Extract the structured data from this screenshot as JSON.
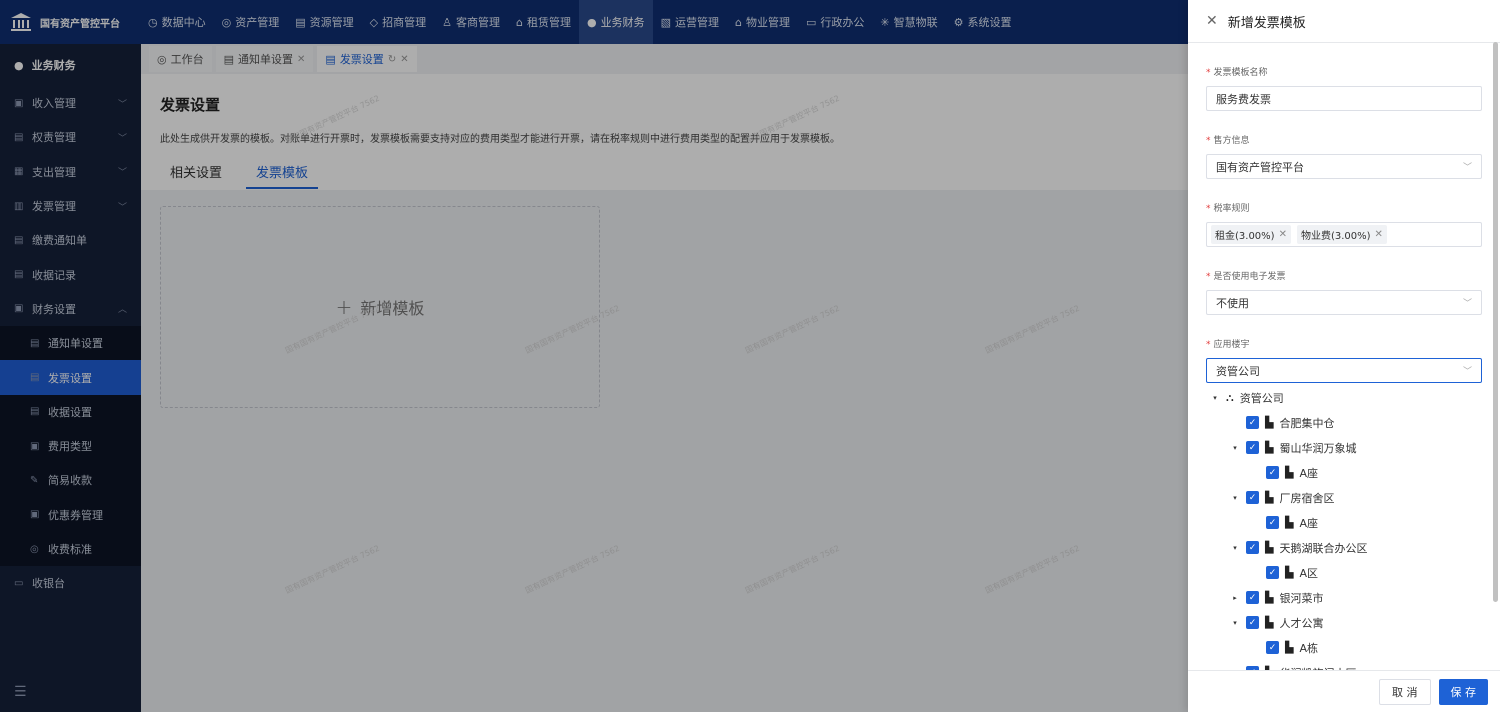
{
  "app": {
    "name": "国有资产管控平台"
  },
  "topnav": [
    {
      "label": "数据中心",
      "icon": "◷"
    },
    {
      "label": "资产管理",
      "icon": "◎"
    },
    {
      "label": "资源管理",
      "icon": "▤"
    },
    {
      "label": "招商管理",
      "icon": "◇"
    },
    {
      "label": "客商管理",
      "icon": "♙"
    },
    {
      "label": "租赁管理",
      "icon": "⌂"
    },
    {
      "label": "业务财务",
      "icon": "●"
    },
    {
      "label": "运营管理",
      "icon": "▧"
    },
    {
      "label": "物业管理",
      "icon": "⌂"
    },
    {
      "label": "行政办公",
      "icon": "▭"
    },
    {
      "label": "智慧物联",
      "icon": "✳"
    },
    {
      "label": "系统设置",
      "icon": "⚙"
    }
  ],
  "sidebar": {
    "header": "业务财务",
    "items": [
      {
        "label": "收入管理",
        "arrow": "﹀"
      },
      {
        "label": "权责管理",
        "arrow": "﹀"
      },
      {
        "label": "支出管理",
        "arrow": "﹀"
      },
      {
        "label": "发票管理",
        "arrow": "﹀"
      },
      {
        "label": "缴费通知单"
      },
      {
        "label": "收据记录"
      },
      {
        "label": "财务设置",
        "arrow": "︿"
      }
    ],
    "subitems": [
      {
        "label": "通知单设置"
      },
      {
        "label": "发票设置"
      },
      {
        "label": "收据设置"
      },
      {
        "label": "费用类型"
      },
      {
        "label": "简易收款"
      },
      {
        "label": "优惠券管理"
      },
      {
        "label": "收费标准"
      }
    ],
    "last": "收银台"
  },
  "tabs": [
    {
      "label": "工作台"
    },
    {
      "label": "通知单设置"
    },
    {
      "label": "发票设置"
    }
  ],
  "page": {
    "title": "发票设置",
    "desc": "此处生成供开发票的模板。对账单进行开票时，发票模板需要支持对应的费用类型才能进行开票，请在税率规则中进行费用类型的配置并应用于发票模板。",
    "subtabs": [
      "相关设置",
      "发票模板"
    ],
    "add_label": "新增模板"
  },
  "watermark": "国有国有资产管控平台 7562",
  "drawer": {
    "title": "新增发票模板",
    "fields": {
      "name": {
        "label": "发票模板名称",
        "value": "服务费发票"
      },
      "seller": {
        "label": "售方信息",
        "value": "国有资产管控平台"
      },
      "tax": {
        "label": "税率规则",
        "tags": [
          "租金(3.00%)",
          "物业费(3.00%)"
        ]
      },
      "einvoice": {
        "label": "是否使用电子发票",
        "value": "不使用"
      },
      "building": {
        "label": "应用楼宇",
        "value": "资管公司"
      }
    },
    "tree": [
      {
        "label": "资管公司",
        "level": 0,
        "toggle": "▾",
        "checked": false,
        "icon": "org"
      },
      {
        "label": "合肥集中仓",
        "level": 1,
        "toggle": "",
        "checked": true
      },
      {
        "label": "蜀山华润万象城",
        "level": 1,
        "toggle": "▾",
        "checked": true
      },
      {
        "label": "A座",
        "level": 2,
        "toggle": "",
        "checked": true
      },
      {
        "label": "厂房宿舍区",
        "level": 1,
        "toggle": "▾",
        "checked": true
      },
      {
        "label": "A座",
        "level": 2,
        "toggle": "",
        "checked": true
      },
      {
        "label": "天鹅湖联合办公区",
        "level": 1,
        "toggle": "▾",
        "checked": true
      },
      {
        "label": "A区",
        "level": 2,
        "toggle": "",
        "checked": true
      },
      {
        "label": "银河菜市",
        "level": 1,
        "toggle": "▸",
        "checked": true
      },
      {
        "label": "人才公寓",
        "level": 1,
        "toggle": "▾",
        "checked": true
      },
      {
        "label": "A栋",
        "level": 2,
        "toggle": "",
        "checked": true
      },
      {
        "label": "华润凯旋门小区",
        "level": 1,
        "toggle": "▾",
        "checked": true
      }
    ],
    "cancel": "取 消",
    "save": "保 存"
  }
}
